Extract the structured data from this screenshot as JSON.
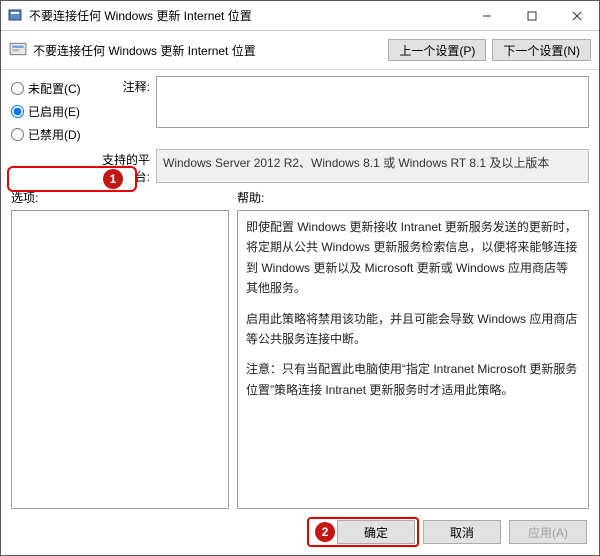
{
  "window": {
    "title": "不要连接任何 Windows 更新 Internet 位置"
  },
  "header": {
    "title": "不要连接任何 Windows 更新 Internet 位置",
    "prev": "上一个设置(P)",
    "next": "下一个设置(N)"
  },
  "radios": {
    "not_configured": "未配置(C)",
    "enabled": "已启用(E)",
    "disabled": "已禁用(D)"
  },
  "labels": {
    "comment": "注释:",
    "supported": "支持的平台:",
    "options": "选项:",
    "help": "帮助:"
  },
  "supported_text": "Windows Server 2012 R2、Windows 8.1 或 Windows RT 8.1 及以上版本",
  "help": {
    "p1": "即使配置 Windows 更新接收 Intranet 更新服务发送的更新时，将定期从公共 Windows 更新服务检索信息，以便将来能够连接到 Windows 更新以及 Microsoft 更新或 Windows 应用商店等其他服务。",
    "p2": "启用此策略将禁用该功能，并且可能会导致 Windows 应用商店等公共服务连接中断。",
    "p3": "注意：只有当配置此电脑使用“指定 Intranet Microsoft 更新服务位置”策略连接 Intranet 更新服务时才适用此策略。"
  },
  "buttons": {
    "ok": "确定",
    "cancel": "取消",
    "apply": "应用(A)"
  },
  "annotations": {
    "badge1": "1",
    "badge2": "2"
  }
}
